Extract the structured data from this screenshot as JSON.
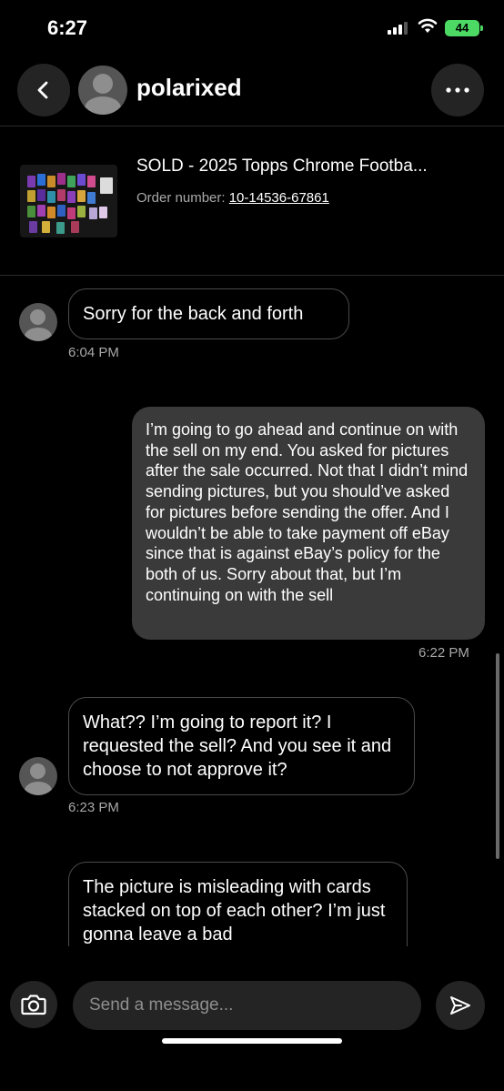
{
  "status_bar": {
    "time": "6:27",
    "battery": "44"
  },
  "header": {
    "username": "polarixed"
  },
  "order": {
    "title": "SOLD - 2025 Topps Chrome Footba...",
    "order_label": "Order number: ",
    "order_number": "10-14536-67861"
  },
  "messages": [
    {
      "direction": "incoming",
      "text": "Sorry for the back and forth",
      "time": "6:04 PM"
    },
    {
      "direction": "outgoing",
      "text": "I’m going to go ahead and continue on with the sell on my end. You asked for pictures after the sale occurred. Not that I didn’t mind sending pictures, but you should’ve asked for pictures before sending the offer. And I wouldn’t be able to take payment off eBay since that is against eBay’s policy for the both of us. Sorry about that, but I’m continuing on with the sell",
      "time": "6:22 PM"
    },
    {
      "direction": "incoming",
      "text": "What?? I’m going to report it? I requested the sell? And you see it and choose to not approve it?",
      "time": "6:23 PM"
    },
    {
      "direction": "incoming",
      "text": "The picture is misleading with cards stacked on top of each other? I’m just gonna leave a bad",
      "time": ""
    }
  ],
  "composer": {
    "placeholder": "Send a message..."
  },
  "colors": {
    "background": "#000000",
    "bubble_outgoing": "#3a3a3a",
    "bubble_incoming_border": "#4a4a4a",
    "battery": "#4cd964"
  },
  "icons": [
    "signal-icon",
    "wifi-icon",
    "back-arrow-icon",
    "more-icon",
    "camera-icon",
    "send-icon"
  ]
}
